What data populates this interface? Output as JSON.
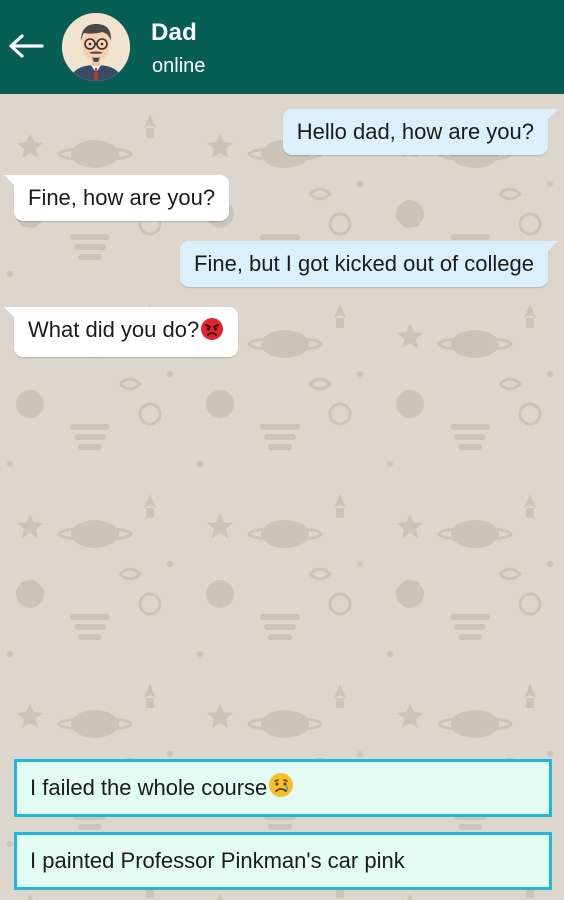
{
  "header": {
    "contact_name": "Dad",
    "status": "online",
    "background_color": "#075e54",
    "back_icon": "arrow-left-icon",
    "avatar_icon": "man-with-glasses-avatar"
  },
  "messages": [
    {
      "direction": "outgoing",
      "text": "Hello dad, how are you?"
    },
    {
      "direction": "incoming",
      "text": "Fine, how are you?"
    },
    {
      "direction": "outgoing",
      "text": "Fine, but I got kicked out of college"
    },
    {
      "direction": "incoming",
      "text": "What did you do?",
      "emoji": "angry-face-icon"
    }
  ],
  "choices": [
    {
      "text": "I failed the whole course",
      "emoji": "sad-face-icon"
    },
    {
      "text": "I painted Professor Pinkman's car pink"
    }
  ],
  "colors": {
    "outgoing_bubble": "#dcf0fb",
    "incoming_bubble": "#ffffff",
    "choice_background": "#e2fbf3",
    "choice_border": "#1fb9de",
    "chat_background": "#dcd6cc"
  }
}
